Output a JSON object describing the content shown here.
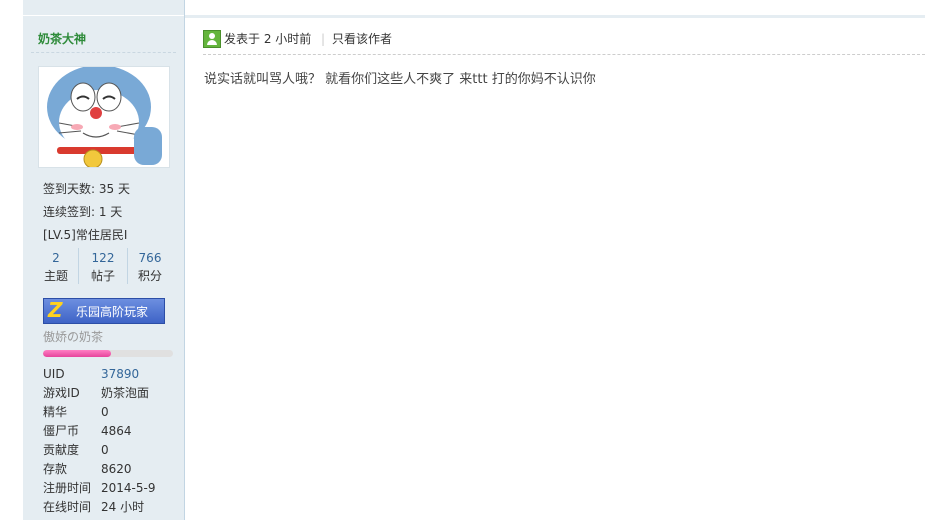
{
  "profile": {
    "username": "奶茶大神",
    "checkin_days": "签到天数: 35 天",
    "streak": "连续签到: 1 天",
    "level": "[LV.5]常住居民I",
    "counts": [
      {
        "value": "2",
        "label": "主题"
      },
      {
        "value": "122",
        "label": "帖子"
      },
      {
        "value": "766",
        "label": "积分"
      }
    ],
    "medal_label": "乐园高阶玩家",
    "medal_glyph": "Z",
    "nickname": "傲娇の奶茶",
    "progress_fraction": 0.52,
    "info": [
      {
        "key": "UID",
        "value": "37890"
      },
      {
        "key": "游戏ID",
        "value": "奶茶泡面"
      },
      {
        "key": "精华",
        "value": "0"
      },
      {
        "key": "僵尸币",
        "value": "4864"
      },
      {
        "key": "贡献度",
        "value": "0"
      },
      {
        "key": "存款",
        "value": "8620"
      },
      {
        "key": "注册时间",
        "value": "2014-5-9"
      },
      {
        "key": "在线时间",
        "value": "24 小时"
      }
    ]
  },
  "post": {
    "time_text": "发表于 2 小时前",
    "separator": "|",
    "only_author": "只看该作者",
    "body": "说实话就叫骂人哦？ 就看你们这些人不爽了 来ttt 打的你妈不认识你"
  },
  "colors": {
    "sidebar_bg": "#e5edf2",
    "username": "#2e8b3a",
    "link": "#336699",
    "online_icon": "#64b53c",
    "progress": "#e6449c"
  }
}
